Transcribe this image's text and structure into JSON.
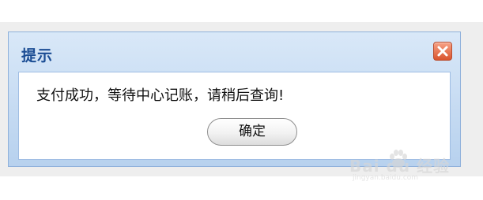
{
  "dialog": {
    "title": "提示",
    "message": "支付成功，等待中心记账，请稍后查询!",
    "ok_label": "确定"
  },
  "watermark": {
    "brand": "Bai du 经验",
    "site": "jingyan.baidu.com"
  },
  "icons": {
    "close": "close-icon",
    "watermark_logo": "baidu-paw-icon"
  },
  "colors": {
    "title_text": "#1b4d94",
    "dialog_gradient_top": "#d9e8f8",
    "dialog_gradient_bottom": "#b7d1ee",
    "close_button": "#d9542e"
  }
}
